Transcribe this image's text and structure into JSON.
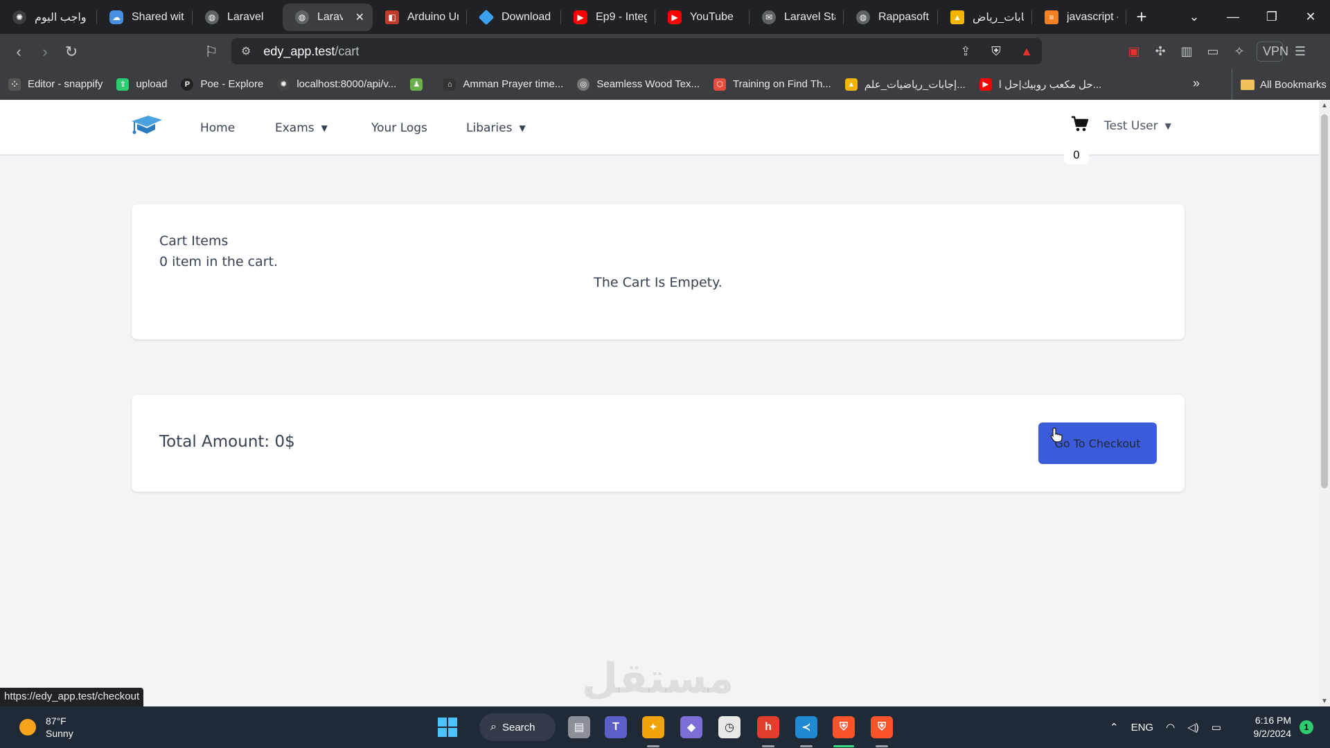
{
  "browser": {
    "tabs": [
      {
        "title": "واجب اليوم",
        "icon": "brain-icon",
        "color": "#e8eaed"
      },
      {
        "title": "Shared wit",
        "icon": "cloud-icon",
        "color": "#4a90e2"
      },
      {
        "title": "Laravel",
        "icon": "globe-icon",
        "color": "#9aa0a6"
      },
      {
        "title": "Larave",
        "icon": "globe-icon",
        "color": "#9aa0a6",
        "active": true
      },
      {
        "title": "Arduino Ur",
        "icon": "code-icon",
        "color": "#c0392b"
      },
      {
        "title": "Download",
        "icon": "diamond-icon",
        "color": "#3aa0f0"
      },
      {
        "title": "Ep9 - Integ",
        "icon": "youtube-icon",
        "color": "#ff0000"
      },
      {
        "title": "YouTube",
        "icon": "youtube-icon",
        "color": "#ff0000"
      },
      {
        "title": "Laravel Sta",
        "icon": "chat-icon",
        "color": "#9aa0a6"
      },
      {
        "title": "Rappasoft",
        "icon": "globe-icon",
        "color": "#9aa0a6"
      },
      {
        "title": "إجابات_رياض",
        "icon": "drive-icon",
        "color": "#f4b400"
      },
      {
        "title": "javascript -",
        "icon": "stack-icon",
        "color": "#f48024"
      }
    ],
    "close_tab": "✕",
    "new_tab": "+",
    "url_host": "edy_app.test",
    "url_path": "/cart",
    "vpn_label": "VPN",
    "bookmarks": [
      {
        "label": "Editor - snappify",
        "color": "#555"
      },
      {
        "label": "upload",
        "color": "#2ecc71"
      },
      {
        "label": "Poe - Explore",
        "color": "#222"
      },
      {
        "label": "localhost:8000/api/v...",
        "color": "#444"
      },
      {
        "label": "",
        "color": "#6ab04c"
      },
      {
        "label": "Amman Prayer time...",
        "color": "#333"
      },
      {
        "label": "Seamless Wood Tex...",
        "color": "#777"
      },
      {
        "label": "Training on Find Th...",
        "color": "#e74c3c"
      },
      {
        "label": "إجابات_رياضيات_علم...",
        "color": "#f4b400"
      },
      {
        "label": "حل مكعب روبيك|حل ا...",
        "color": "#ff0000"
      }
    ],
    "all_bookmarks": "All Bookmarks",
    "status_url": "https://edy_app.test/checkout"
  },
  "page": {
    "nav": {
      "home": "Home",
      "exams": "Exams",
      "your_logs": "Your Logs",
      "libaries": "Libaries"
    },
    "cart_count": "0",
    "user_name": "Test User",
    "cart_items_label": "Cart Items",
    "cart_count_text": "0 item in the cart.",
    "empty_text": "The Cart Is Empety.",
    "total_amount": "Total Amount: 0$",
    "checkout_label": "Go To Checkout",
    "accent_color": "#3b5bdb"
  },
  "taskbar": {
    "temperature": "87°F",
    "condition": "Sunny",
    "search_label": "Search",
    "language": "ENG",
    "time": "6:16 PM",
    "date": "9/2/2024",
    "notifications": "1"
  },
  "watermark": "مستقل"
}
